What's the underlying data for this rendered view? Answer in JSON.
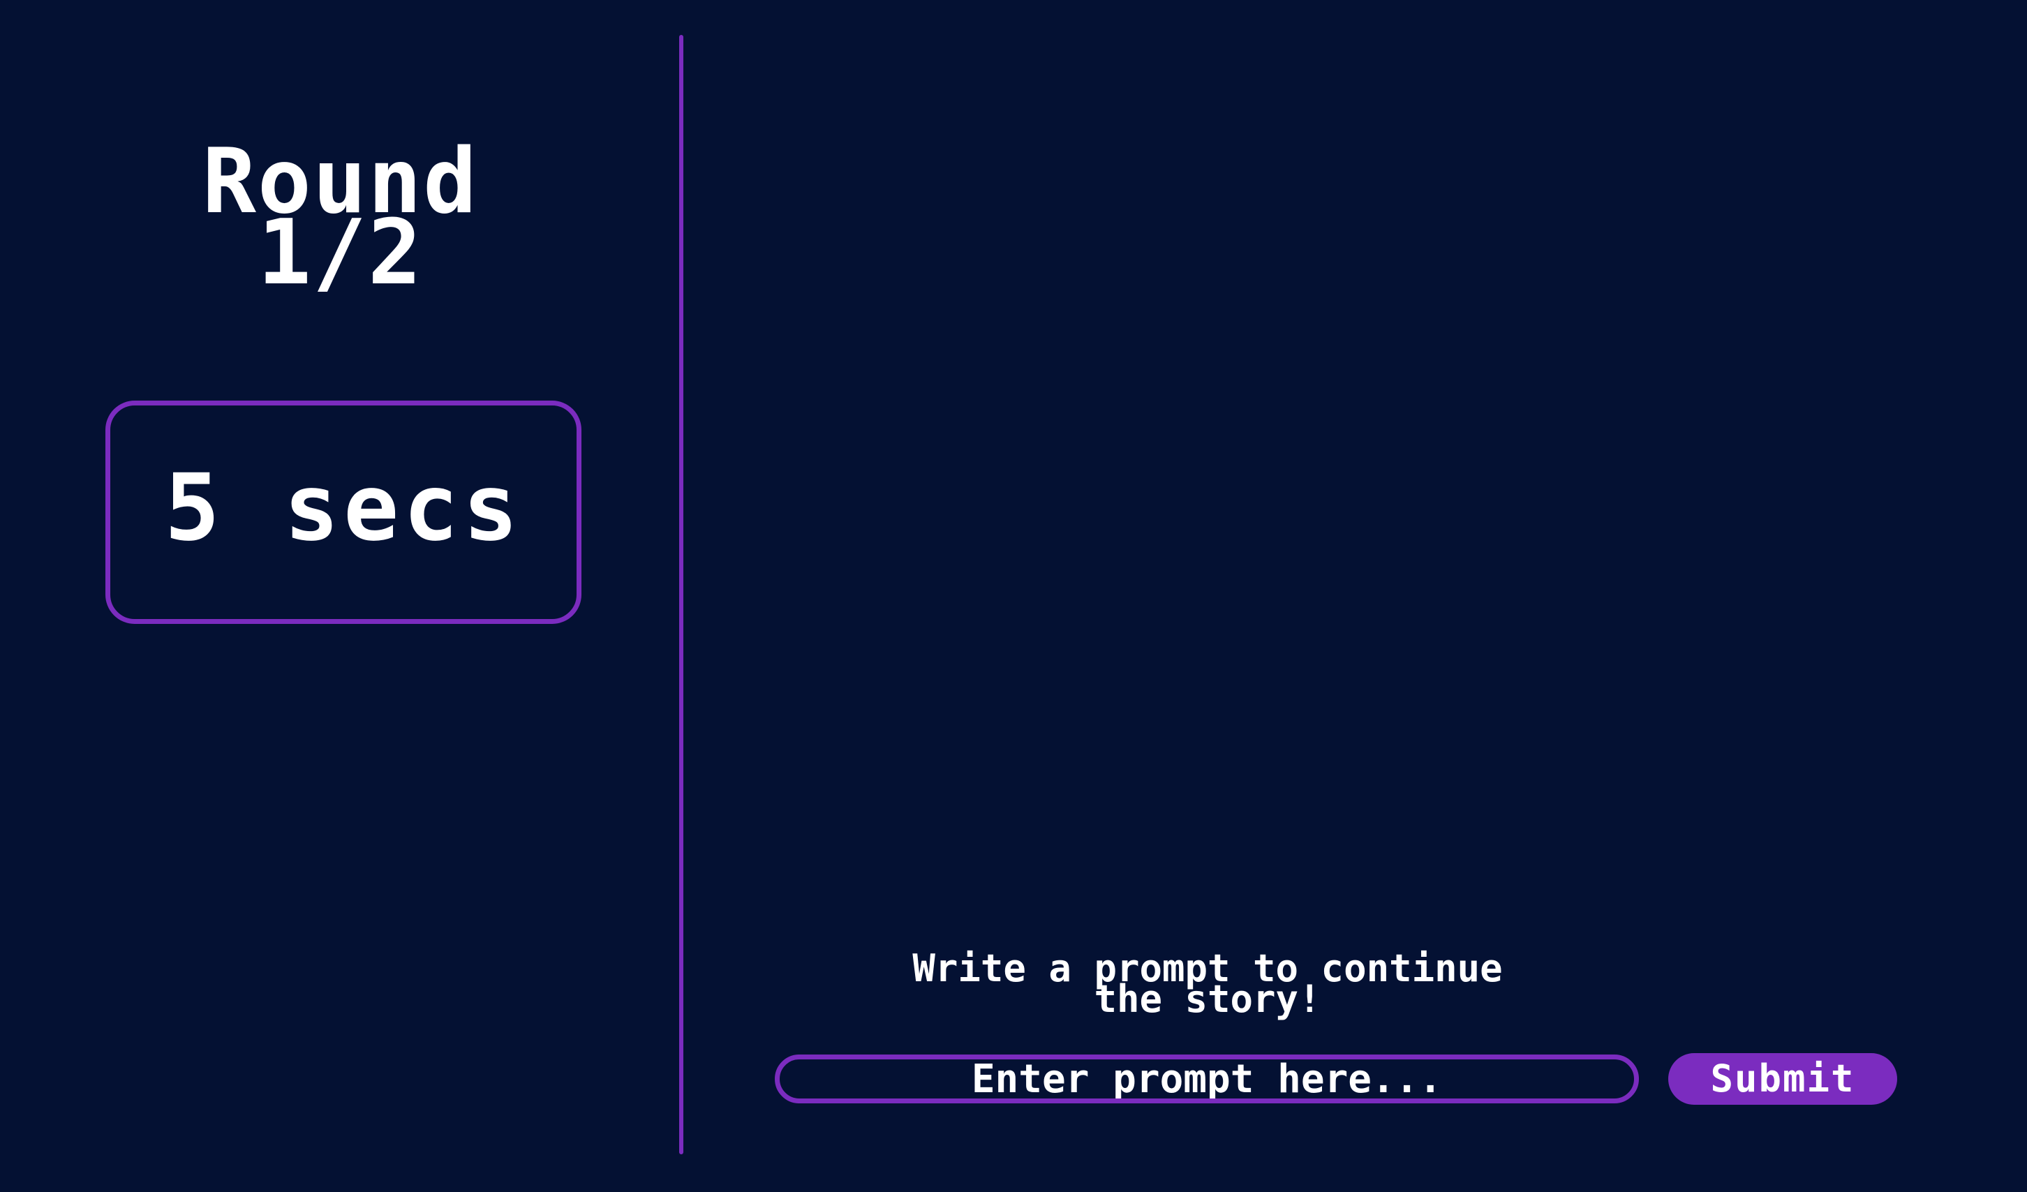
{
  "round": {
    "line1": "Round",
    "line2": "1/2"
  },
  "timer": {
    "text": "5 secs"
  },
  "story": {
    "instruction_line1": "Write a prompt to continue",
    "instruction_line2": "the story!"
  },
  "prompt": {
    "placeholder": "Enter prompt here...",
    "value": ""
  },
  "submit": {
    "label": "Submit"
  },
  "colors": {
    "background": "#041133",
    "accent": "#7b2cbf",
    "text": "#ffffff"
  }
}
